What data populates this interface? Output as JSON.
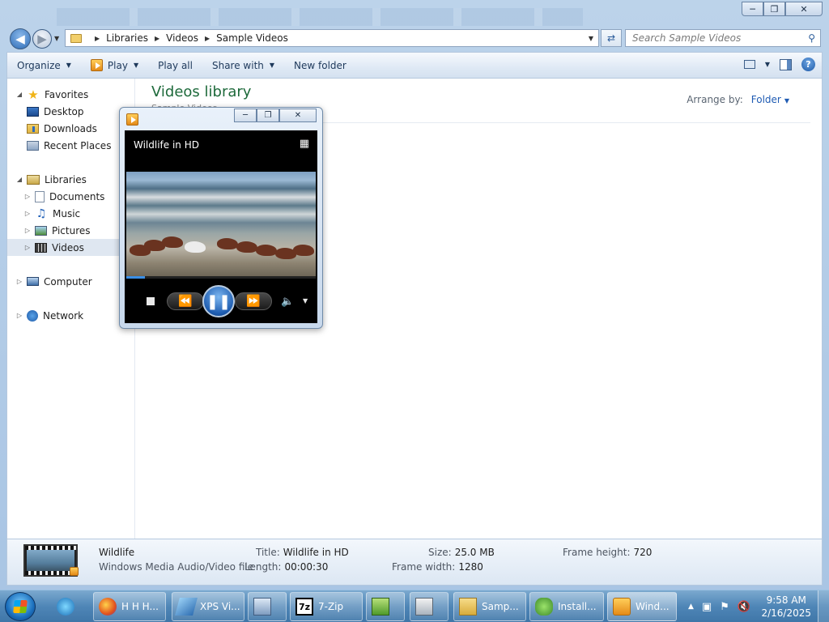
{
  "address": {
    "crumbs": [
      "Libraries",
      "Videos",
      "Sample Videos"
    ],
    "search_placeholder": "Search Sample Videos"
  },
  "toolbar": {
    "organize": "Organize",
    "play": "Play",
    "play_all": "Play all",
    "share_with": "Share with",
    "new_folder": "New folder"
  },
  "navpane": {
    "favorites": "Favorites",
    "desktop": "Desktop",
    "downloads": "Downloads",
    "recent_places": "Recent Places",
    "libraries": "Libraries",
    "documents": "Documents",
    "music": "Music",
    "pictures": "Pictures",
    "videos": "Videos",
    "computer": "Computer",
    "network": "Network"
  },
  "library": {
    "title": "Videos library",
    "subtitle": "Sample Videos",
    "arrange_label": "Arrange by:",
    "arrange_value": "Folder"
  },
  "player": {
    "title": "Wildlife in HD",
    "progress_fraction": 0.1
  },
  "details": {
    "name": "Wildlife",
    "type": "Windows Media Audio/Video file",
    "props": [
      {
        "label": "Title:",
        "value": "Wildlife in HD"
      },
      {
        "label": "Length:",
        "value": "00:00:30"
      },
      {
        "label": "Size:",
        "value": "25.0 MB"
      },
      {
        "label": "Frame width:",
        "value": "1280"
      },
      {
        "label": "Frame height:",
        "value": "720"
      }
    ]
  },
  "taskbar": {
    "items": [
      {
        "label": "H H H..."
      },
      {
        "label": "XPS Vi..."
      },
      {
        "label": "7-Zip"
      },
      {
        "label": "Samp..."
      },
      {
        "label": "Install..."
      },
      {
        "label": "Wind..."
      }
    ],
    "time": "9:58 AM",
    "date": "2/16/2025"
  }
}
